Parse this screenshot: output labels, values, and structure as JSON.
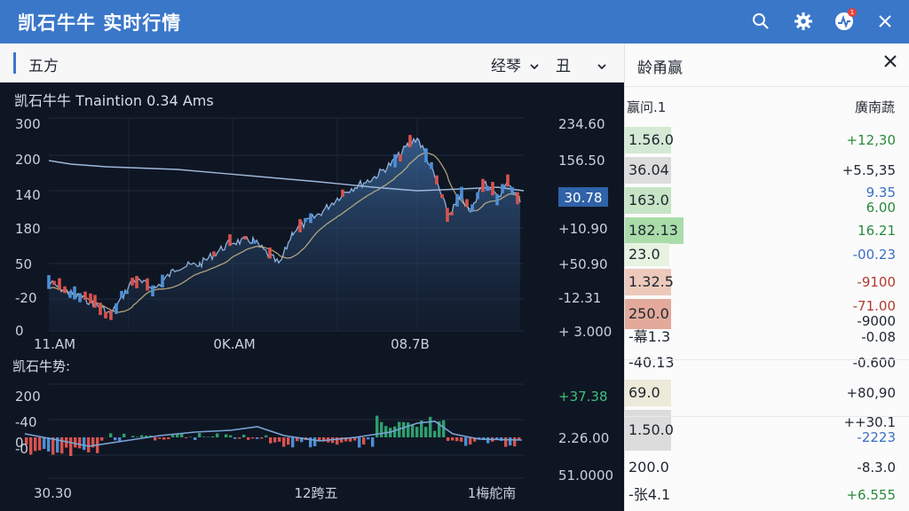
{
  "titlebar": {
    "title": "凯石牛牛 实时行情",
    "icons": [
      "search-icon",
      "gear-icon",
      "activity-icon",
      "close-icon"
    ],
    "notification_badge": "1"
  },
  "toolbar": {
    "section_title": "五方",
    "dropdown_1": "经琴",
    "dropdown_2": "丑"
  },
  "main_chart": {
    "title": "凯石牛牛 Tnaintion 0.34 Ams",
    "left_ticks": [
      "300",
      "200",
      "140",
      "180",
      "50",
      "-20",
      "0"
    ],
    "right_ticks": [
      "234.60",
      "156.50",
      "+10.90",
      "+50.90",
      "-12.31",
      "+ 3.000"
    ],
    "price_tag": "30.78",
    "x_ticks": [
      "11.AM",
      "0K.AM",
      "08.7B"
    ]
  },
  "sub_chart": {
    "title": "凯石牛势:",
    "left_ticks": [
      "200",
      "-40",
      "0",
      "-0"
    ],
    "right_ticks": [
      "+37.38",
      "2.26.00",
      "51.0000"
    ],
    "x_ticks": [
      "30.30",
      "12跨五",
      "1梅舵南"
    ]
  },
  "quote_panel": {
    "title": "龄甬赢",
    "col_left": "赢问.1",
    "col_right": "廣南蔬",
    "rows": [
      {
        "left": "1.56.0",
        "right": [
          "+12,30"
        ]
      },
      {
        "left": "36.04",
        "right": [
          "+5.5,35"
        ]
      },
      {
        "left": "163.0",
        "right": [
          "9.35",
          "6.00"
        ]
      },
      {
        "left": "182.13",
        "right": [
          "16.21"
        ]
      },
      {
        "left": "23.0",
        "right": [
          "-00.23"
        ]
      },
      {
        "left": "1.32.5",
        "right": [
          "-9100"
        ]
      },
      {
        "left": "250.0",
        "right": [
          "-71.00",
          "-9000"
        ]
      },
      {
        "left": "-幕1.3",
        "right": [
          "-0.08"
        ]
      },
      {
        "left": "-40.13",
        "right": [
          "-0.600"
        ]
      },
      {
        "left": "69.0",
        "right": [
          "+80,90"
        ]
      },
      {
        "left": "1.50.0",
        "right": [
          "++30.1",
          "-2223"
        ]
      },
      {
        "left": "200.0",
        "right": [
          "-8.3.0"
        ]
      },
      {
        "left": "-张4.1",
        "right": [
          "+6.555"
        ]
      }
    ]
  },
  "colors": {
    "titlebar": "#3a77c9",
    "chart_bg": "#0f1623",
    "up": "#2f9e6e",
    "down": "#d9534f",
    "price_line": "#8fb1dc",
    "ma_line": "#c8b98a"
  }
}
